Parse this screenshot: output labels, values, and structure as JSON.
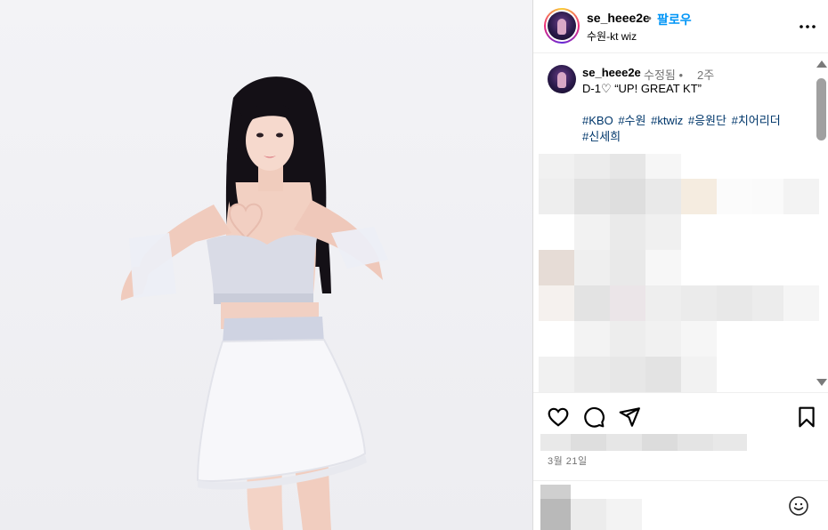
{
  "post": {
    "username": "se_heee2e",
    "follow_label": "팔로우",
    "separator": "•",
    "location": "수원-kt wiz"
  },
  "caption": {
    "username": "se_heee2e",
    "edited": "수정됨 •",
    "time": "2주",
    "text": "D-1♡ “UP! GREAT KT”",
    "hashtags": [
      "#KBO",
      "#수원",
      "#ktwiz",
      "#응원단",
      "#치어리더",
      "#신세희"
    ]
  },
  "footer": {
    "date": "3월 21일"
  },
  "icons": {
    "more": "more-horizontal-icon",
    "like": "heart-icon",
    "comment": "comment-bubble-icon",
    "share": "paper-plane-icon",
    "save": "bookmark-icon",
    "emoji": "smiley-icon"
  },
  "colors": {
    "link": "#0095f6",
    "hashtag": "#00376b",
    "muted": "#737373"
  }
}
